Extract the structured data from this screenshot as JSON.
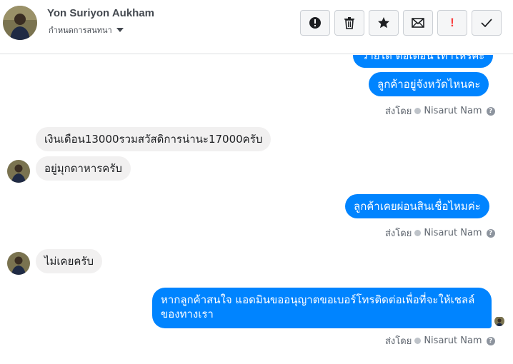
{
  "contact": {
    "name": "Yon Suriyon Aukham",
    "status": "กำหนดการสนทนา"
  },
  "actions": [
    {
      "name": "spam-report-button",
      "icon": "alert-circle-icon"
    },
    {
      "name": "delete-button",
      "icon": "trash-icon"
    },
    {
      "name": "star-button",
      "icon": "star-icon"
    },
    {
      "name": "mark-unread-button",
      "icon": "envelope-icon"
    },
    {
      "name": "follow-up-button",
      "icon": "exclamation-icon",
      "label": "!"
    },
    {
      "name": "mark-done-button",
      "icon": "check-icon"
    }
  ],
  "messages": {
    "m0": "ว่ายได้ ต่อเดือน เท่าไหร่คะ",
    "m1": "ลูกค้าอยู่จังหวัดไหนคะ",
    "s1_prefix": "ส่งโดย",
    "s1_agent": "Nisarut Nam",
    "m2": "เงินเดือน13000รวมสวัสดิการน่านะ17000ครับ",
    "m3": "อยู่มุกดาหารครับ",
    "m4": "ลูกค้าเคยผ่อนสินเชื่อไหมค่ะ",
    "s2_prefix": "ส่งโดย",
    "s2_agent": "Nisarut Nam",
    "m5": "ไม่เคยครับ",
    "m6_line1": "หากลูกค้าสนใจ แอดมินขออนุญาตขอเบอร์โทรติดต่อเพื่อที่จะให้เชลล์",
    "m6_line2": "ของทางเรา",
    "s3_prefix": "ส่งโดย",
    "s3_agent": "Nisarut Nam"
  },
  "colors": {
    "outgoing": "#0084ff",
    "incoming": "#f1f0f0",
    "alert": "#fa3e3e"
  }
}
